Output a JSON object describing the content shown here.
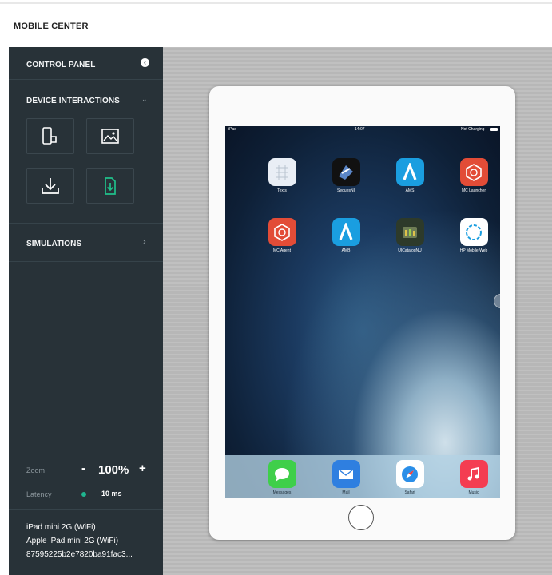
{
  "app": {
    "title": "MOBILE CENTER"
  },
  "sidebar": {
    "control_panel_label": "CONTROL PANEL",
    "device_interactions_label": "DEVICE INTERACTIONS",
    "interaction_tiles": [
      {
        "icon": "rotate-device-icon"
      },
      {
        "icon": "image-icon"
      },
      {
        "icon": "download-icon"
      },
      {
        "icon": "install-app-icon"
      }
    ],
    "simulations_label": "SIMULATIONS",
    "zoom_label": "Zoom",
    "zoom_minus": "-",
    "zoom_value": "100%",
    "zoom_plus": "+",
    "latency_label": "Latency",
    "latency_value": "10 ms",
    "device_name": "iPad mini 2G (WiFi)",
    "device_model": "Apple iPad mini 2G (WiFi)",
    "device_id": "87595225b2e7820ba91fac3..."
  },
  "device": {
    "status_bar": {
      "carrier": "iPad",
      "time": "14:07",
      "battery": "Not Charging"
    },
    "apps": [
      {
        "label": "Texts",
        "icon": "texts-app-icon",
        "color": "#e9eef5"
      },
      {
        "label": "SequesNI",
        "icon": "sequesni-app-icon",
        "color": "#111111"
      },
      {
        "label": "AMS",
        "icon": "ams-app-icon",
        "color": "#1a9ee0"
      },
      {
        "label": "MC Launcher",
        "icon": "mc-launcher-app-icon",
        "color": "#e24c37"
      },
      {
        "label": "MC Agent",
        "icon": "mc-agent-app-icon",
        "color": "#e24c37"
      },
      {
        "label": "AMB",
        "icon": "amb-app-icon",
        "color": "#1a9ee0"
      },
      {
        "label": "UICatalogNU",
        "icon": "uicatalog-app-icon",
        "color": "#2d3a2a"
      },
      {
        "label": "HP Mobile Web",
        "icon": "hp-mobile-web-app-icon",
        "color": "#ffffff"
      }
    ],
    "dock": [
      {
        "label": "Messages",
        "icon": "messages-app-icon",
        "color": "#3fcf4a"
      },
      {
        "label": "Mail",
        "icon": "mail-app-icon",
        "color": "#2f7fe0"
      },
      {
        "label": "Safari",
        "icon": "safari-app-icon",
        "color": "#2a8ee8"
      },
      {
        "label": "Music",
        "icon": "music-app-icon",
        "color": "#f43d52"
      }
    ]
  }
}
